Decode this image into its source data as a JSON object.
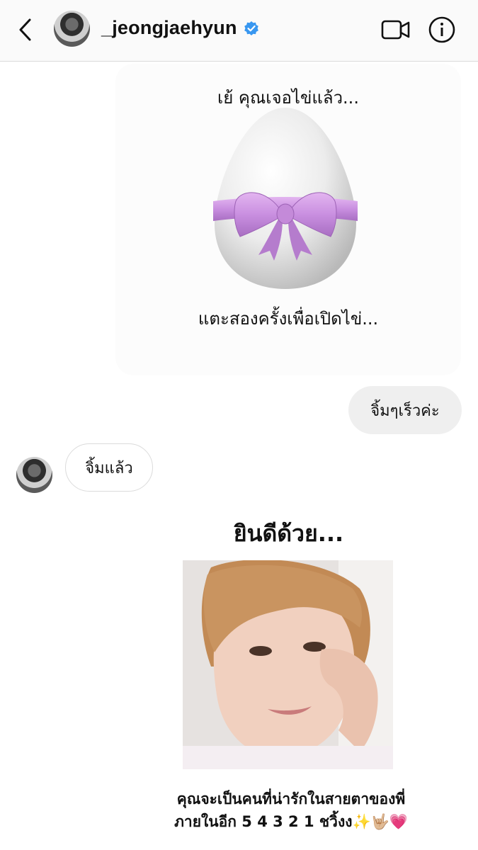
{
  "header": {
    "username": "_jeongjaehyun",
    "verified": true,
    "back_icon": "chevron-left-icon",
    "video_icon": "video-call-icon",
    "info_icon": "info-icon"
  },
  "messages": {
    "egg_story": {
      "top_text": "เย้ คุณเจอไข่แล้ว...",
      "bottom_text": "แตะสองครั้งเพื่อเปิดไข่...",
      "ribbon_color": "#c98fe0"
    },
    "outgoing_reply": "จิ้มๆเร็วค่ะ",
    "incoming_reply": "จิ้มแล้ว",
    "result_story": {
      "heading": "ยินดีด้วย...",
      "caption_line1": "คุณจะเป็นคนที่น่ารักในสายตาของพี่",
      "caption_line2": "ภายในอีก  5 4 3 2 1  ชวิ้งง✨🤟🏼💗"
    }
  },
  "colors": {
    "verified_blue": "#3897f0",
    "bubble_gray": "#efefef",
    "border": "#dbdbdb"
  }
}
